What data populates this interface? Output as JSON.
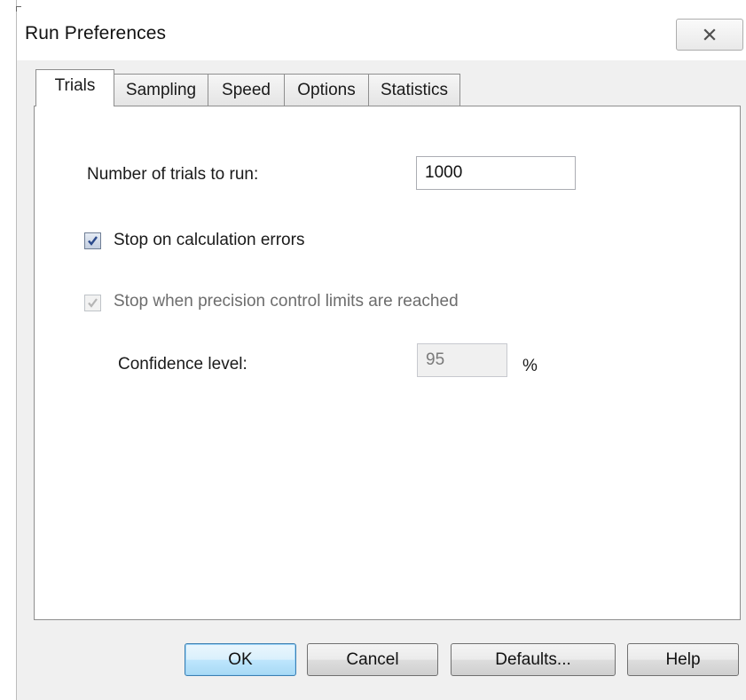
{
  "window": {
    "title": "Run Preferences",
    "close_icon": "close-x-icon"
  },
  "tabs": [
    {
      "label": "Trials",
      "active": true
    },
    {
      "label": "Sampling",
      "active": false
    },
    {
      "label": "Speed",
      "active": false
    },
    {
      "label": "Options",
      "active": false
    },
    {
      "label": "Statistics",
      "active": false
    }
  ],
  "trials": {
    "num_trials_label": "Number of trials to run:",
    "num_trials_value": "1000",
    "stop_on_errors_label": "Stop on calculation errors",
    "stop_on_errors_checked": true,
    "stop_on_precision_label": "Stop when precision control limits are reached",
    "stop_on_precision_checked": true,
    "stop_on_precision_enabled": false,
    "confidence_label": "Confidence level:",
    "confidence_value": "95",
    "confidence_unit": "%"
  },
  "buttons": {
    "ok": "OK",
    "cancel": "Cancel",
    "defaults": "Defaults...",
    "help": "Help"
  },
  "colors": {
    "checkmark": "#2b4a8b",
    "checkmark_disabled": "#b5b5b5",
    "default_button_border": "#3c7fb1"
  }
}
